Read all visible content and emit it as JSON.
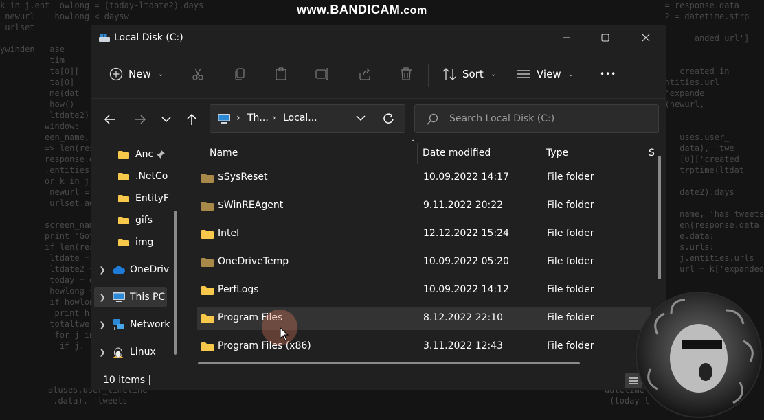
{
  "watermark": {
    "main": "www.BANDICAM",
    "suffix": ".com"
  },
  "window": {
    "title": "Local Disk (C:)"
  },
  "toolbar": {
    "new_label": "New",
    "sort_label": "Sort",
    "view_label": "View",
    "more_label": "•••"
  },
  "address": {
    "segments": [
      "Th...",
      "Local..."
    ]
  },
  "search": {
    "placeholder": "Search Local Disk (C:)"
  },
  "sidebar": {
    "pinned": [
      {
        "label": "Anc",
        "icon": "folder-icon",
        "pinned": true
      },
      {
        "label": ".NetCo",
        "icon": "folder-icon"
      },
      {
        "label": "EntityF",
        "icon": "folder-icon"
      },
      {
        "label": "gifs",
        "icon": "folder-icon"
      },
      {
        "label": "img",
        "icon": "folder-icon"
      }
    ],
    "locations": [
      {
        "label": "OneDriv",
        "icon": "cloud-icon"
      },
      {
        "label": "This PC",
        "icon": "computer-icon",
        "selected": true
      },
      {
        "label": "Network",
        "icon": "network-icon"
      },
      {
        "label": "Linux",
        "icon": "linux-icon"
      }
    ]
  },
  "columns": {
    "name": "Name",
    "date": "Date modified",
    "type": "Type",
    "size": "S"
  },
  "files": [
    {
      "name": "$SysReset",
      "date": "10.09.2022 14:17",
      "type": "File folder",
      "dim": true
    },
    {
      "name": "$WinREAgent",
      "date": "9.11.2022 20:22",
      "type": "File folder",
      "dim": true
    },
    {
      "name": "Intel",
      "date": "12.12.2022 15:24",
      "type": "File folder",
      "dim": false
    },
    {
      "name": "OneDriveTemp",
      "date": "10.09.2022 05:20",
      "type": "File folder",
      "dim": true
    },
    {
      "name": "PerfLogs",
      "date": "10.09.2022 14:12",
      "type": "File folder",
      "dim": false
    },
    {
      "name": "Program Files",
      "date": "8.12.2022 22:10",
      "type": "File folder",
      "dim": false,
      "hover": true
    },
    {
      "name": "Program Files (x86)",
      "date": "3.11.2022 12:43",
      "type": "File folder",
      "dim": false
    }
  ],
  "status": {
    "item_count": "10 items"
  },
  "colors": {
    "folder": "#f8c84a",
    "folder_dim": "#a9894a",
    "background": "#202020",
    "accent": "#4cc2ff"
  }
}
